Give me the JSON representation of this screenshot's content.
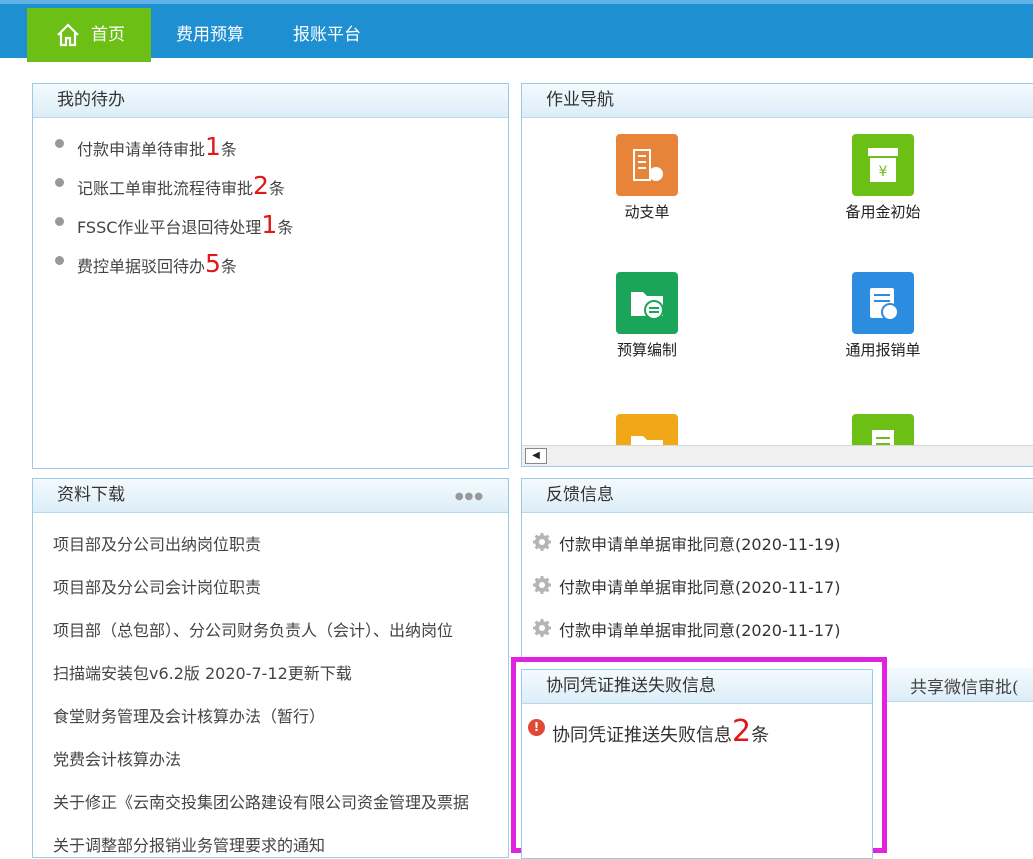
{
  "nav": {
    "home": "首页",
    "budget": "费用预算",
    "report": "报账平台"
  },
  "todo": {
    "title": "我的待办",
    "items": [
      {
        "text": "付款申请单待审批",
        "count": "1",
        "unit": "条"
      },
      {
        "text": "记账工单审批流程待审批",
        "count": "2",
        "unit": "条"
      },
      {
        "text": "FSSC作业平台退回待处理",
        "count": "1",
        "unit": "条"
      },
      {
        "text": "费控单据驳回待办",
        "count": "5",
        "unit": "条"
      }
    ]
  },
  "nav_panel": {
    "title": "作业导航",
    "tiles": [
      {
        "label": "动支单",
        "color": "#e8843a",
        "icon": "building-doc-icon"
      },
      {
        "label": "备用金初始",
        "color": "#6cbf15",
        "icon": "yen-box-icon"
      },
      {
        "label": "预算编制",
        "color": "#1aa55a",
        "icon": "folder-exchange-icon"
      },
      {
        "label": "通用报销单",
        "color": "#2b8ce0",
        "icon": "receipt-icon"
      },
      {
        "label": "",
        "color": "#f0a818",
        "icon": "folder-icon"
      },
      {
        "label": "",
        "color": "#6cbf15",
        "icon": "document-icon"
      }
    ]
  },
  "downloads": {
    "title": "资料下载",
    "items": [
      "项目部及分公司出纳岗位职责",
      "项目部及分公司会计岗位职责",
      "项目部（总包部）、分公司财务负责人（会计）、出纳岗位",
      "扫描端安装包v6.2版 2020-7-12更新下载",
      "食堂财务管理及会计核算办法（暂行）",
      "党费会计核算办法",
      "关于修正《云南交投集团公路建设有限公司资金管理及票据",
      "关于调整部分报销业务管理要求的通知"
    ]
  },
  "feedback": {
    "title": "反馈信息",
    "items": [
      "付款申请单单据审批同意(2020-11-19)",
      "付款申请单单据审批同意(2020-11-17)",
      "付款申请单单据审批同意(2020-11-17)"
    ]
  },
  "sync_fail": {
    "title": "协同凭证推送失败信息",
    "text": "协同凭证推送失败信息",
    "count": "2",
    "unit": "条"
  },
  "wechat": {
    "title": "共享微信审批("
  }
}
